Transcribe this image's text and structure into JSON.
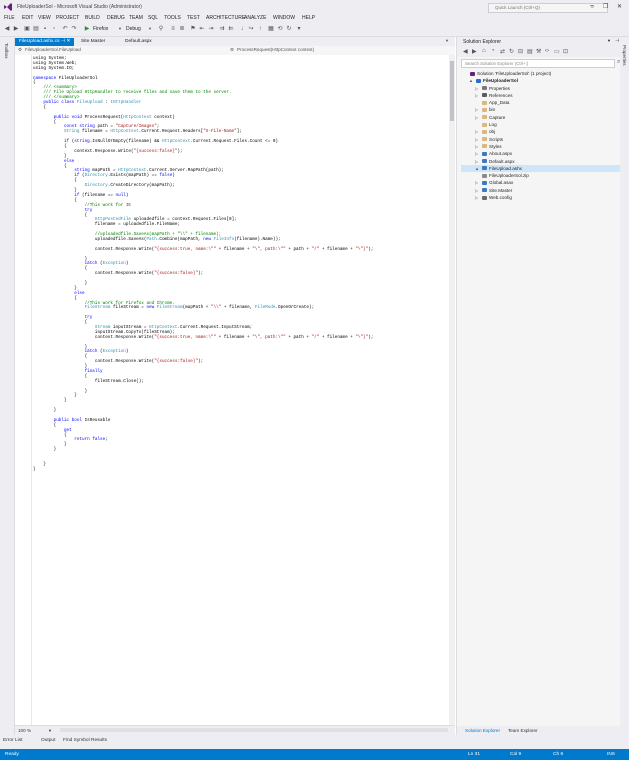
{
  "window": {
    "title": "FileUploaderSol - Microsoft Visual Studio (Administrator)",
    "quick_launch_placeholder": "Quick Launch (Ctrl+Q)",
    "menu": [
      "FILE",
      "EDIT",
      "VIEW",
      "PROJECT",
      "BUILD",
      "DEBUG",
      "TEAM",
      "SQL",
      "TOOLS",
      "TEST",
      "ARCHITECTURE",
      "ANALYZE",
      "WINDOW",
      "HELP"
    ]
  },
  "toolbar": {
    "browser": "Firefox",
    "config": "Debug"
  },
  "toolbox_label": "Toolbox",
  "tabs": [
    {
      "label": "FileUpload.ashx.cs",
      "active": true
    },
    {
      "label": "Site.Master",
      "active": false
    },
    {
      "label": "Default.aspx",
      "active": false
    }
  ],
  "navbar": {
    "left": "FileUploaderSol.FileUpload",
    "right": "ProcessRequest(HttpContext context)"
  },
  "code": [
    [
      {
        "t": "using System;",
        "k": "p"
      }
    ],
    [
      {
        "t": "using System.Web;",
        "k": "p"
      }
    ],
    [
      {
        "t": "using System.IO;",
        "k": "p"
      }
    ],
    [
      {
        "t": "",
        "k": "p"
      }
    ],
    [
      {
        "t": "namespace",
        "k": "kw"
      },
      {
        "t": " FileUploaderSol",
        "k": "p"
      }
    ],
    [
      {
        "t": "{",
        "k": "p"
      }
    ],
    [
      {
        "t": "    /// <summary>",
        "k": "cm"
      }
    ],
    [
      {
        "t": "    /// File Upload HttpHandler to receive files and save them to the server.",
        "k": "cm"
      }
    ],
    [
      {
        "t": "    /// </summary>",
        "k": "cm"
      }
    ],
    [
      {
        "t": "    public class ",
        "k": "kw"
      },
      {
        "t": "FileUpload",
        "k": "ty"
      },
      {
        "t": " : ",
        "k": "p"
      },
      {
        "t": "IHttpHandler",
        "k": "ty"
      }
    ],
    [
      {
        "t": "    {",
        "k": "p"
      }
    ],
    [
      {
        "t": "",
        "k": "p"
      }
    ],
    [
      {
        "t": "        public void ",
        "k": "kw"
      },
      {
        "t": "ProcessRequest(",
        "k": "p"
      },
      {
        "t": "HttpContext",
        "k": "ty"
      },
      {
        "t": " context)",
        "k": "p"
      }
    ],
    [
      {
        "t": "        {",
        "k": "p"
      }
    ],
    [
      {
        "t": "            const string ",
        "k": "kw"
      },
      {
        "t": "path = ",
        "k": "p"
      },
      {
        "t": "\"Capture/Images\"",
        "k": "str"
      },
      {
        "t": ";",
        "k": "p"
      }
    ],
    [
      {
        "t": "            String ",
        "k": "ty"
      },
      {
        "t": "filename = ",
        "k": "p"
      },
      {
        "t": "HttpContext",
        "k": "ty"
      },
      {
        "t": ".Current.Request.Headers[",
        "k": "p"
      },
      {
        "t": "\"X-File-Name\"",
        "k": "str"
      },
      {
        "t": "];",
        "k": "p"
      }
    ],
    [
      {
        "t": "",
        "k": "p"
      }
    ],
    [
      {
        "t": "            if ",
        "k": "kw"
      },
      {
        "t": "(",
        "k": "p"
      },
      {
        "t": "string",
        "k": "kw"
      },
      {
        "t": ".IsNullOrEmpty(filename) && ",
        "k": "p"
      },
      {
        "t": "HttpContext",
        "k": "ty"
      },
      {
        "t": ".Current.Request.Files.Count <= 0)",
        "k": "p"
      }
    ],
    [
      {
        "t": "            {",
        "k": "p"
      }
    ],
    [
      {
        "t": "                context.Response.Write(",
        "k": "p"
      },
      {
        "t": "\"{success:false}\"",
        "k": "str"
      },
      {
        "t": ");",
        "k": "p"
      }
    ],
    [
      {
        "t": "            }",
        "k": "p"
      }
    ],
    [
      {
        "t": "            else",
        "k": "kw"
      }
    ],
    [
      {
        "t": "            {",
        "k": "p"
      }
    ],
    [
      {
        "t": "                string ",
        "k": "kw"
      },
      {
        "t": "mapPath = ",
        "k": "p"
      },
      {
        "t": "HttpContext",
        "k": "ty"
      },
      {
        "t": ".Current.Server.MapPath(path);",
        "k": "p"
      }
    ],
    [
      {
        "t": "                if ",
        "k": "kw"
      },
      {
        "t": "(",
        "k": "p"
      },
      {
        "t": "Directory",
        "k": "ty"
      },
      {
        "t": ".Exists(mapPath) == ",
        "k": "p"
      },
      {
        "t": "false",
        "k": "kw"
      },
      {
        "t": ")",
        "k": "p"
      }
    ],
    [
      {
        "t": "                {",
        "k": "p"
      }
    ],
    [
      {
        "t": "                    Directory",
        "k": "ty"
      },
      {
        "t": ".CreateDirectory(mapPath);",
        "k": "p"
      }
    ],
    [
      {
        "t": "                }",
        "k": "p"
      }
    ],
    [
      {
        "t": "                if ",
        "k": "kw"
      },
      {
        "t": "(filename == ",
        "k": "p"
      },
      {
        "t": "null",
        "k": "kw"
      },
      {
        "t": ")",
        "k": "p"
      }
    ],
    [
      {
        "t": "                {",
        "k": "p"
      }
    ],
    [
      {
        "t": "                    //This work for IE",
        "k": "cm"
      }
    ],
    [
      {
        "t": "                    try",
        "k": "kw"
      }
    ],
    [
      {
        "t": "                    {",
        "k": "p"
      }
    ],
    [
      {
        "t": "                        HttpPostedFile ",
        "k": "ty"
      },
      {
        "t": "uploadedfile = context.Request.Files[0];",
        "k": "p"
      }
    ],
    [
      {
        "t": "                        filename = uploadedfile.FileName;",
        "k": "p"
      }
    ],
    [
      {
        "t": "",
        "k": "p"
      }
    ],
    [
      {
        "t": "                        //uploadedfile.SaveAs(mapPath + \"\\\\\" + filename);",
        "k": "cm"
      }
    ],
    [
      {
        "t": "                        uploadedfile.SaveAs(",
        "k": "p"
      },
      {
        "t": "Path",
        "k": "ty"
      },
      {
        "t": ".Combine(mapPath, ",
        "k": "p"
      },
      {
        "t": "new ",
        "k": "kw"
      },
      {
        "t": "FileInfo",
        "k": "ty"
      },
      {
        "t": "(filename).Name));",
        "k": "p"
      }
    ],
    [
      {
        "t": "",
        "k": "p"
      }
    ],
    [
      {
        "t": "                        context.Response.Write(",
        "k": "p"
      },
      {
        "t": "\"{success:true, name:\\\"\"",
        "k": "str"
      },
      {
        "t": " + filename + ",
        "k": "p"
      },
      {
        "t": "\"\\\", path:\\\"\"",
        "k": "str"
      },
      {
        "t": " + path + ",
        "k": "p"
      },
      {
        "t": "\"/\"",
        "k": "str"
      },
      {
        "t": " + filename + ",
        "k": "p"
      },
      {
        "t": "\"\\\"}\"",
        "k": "str"
      },
      {
        "t": ");",
        "k": "p"
      }
    ],
    [
      {
        "t": "",
        "k": "p"
      }
    ],
    [
      {
        "t": "                    }",
        "k": "p"
      }
    ],
    [
      {
        "t": "                    catch ",
        "k": "kw"
      },
      {
        "t": "(",
        "k": "p"
      },
      {
        "t": "Exception",
        "k": "ty"
      },
      {
        "t": ")",
        "k": "p"
      }
    ],
    [
      {
        "t": "                    {",
        "k": "p"
      }
    ],
    [
      {
        "t": "                        context.Response.Write(",
        "k": "p"
      },
      {
        "t": "\"{success:false}\"",
        "k": "str"
      },
      {
        "t": ");",
        "k": "p"
      }
    ],
    [
      {
        "t": "",
        "k": "p"
      }
    ],
    [
      {
        "t": "                    }",
        "k": "p"
      }
    ],
    [
      {
        "t": "                }",
        "k": "p"
      }
    ],
    [
      {
        "t": "                else",
        "k": "kw"
      }
    ],
    [
      {
        "t": "                {",
        "k": "p"
      }
    ],
    [
      {
        "t": "                    //This work for Firefox and Chrome.",
        "k": "cm"
      }
    ],
    [
      {
        "t": "                    FileStream ",
        "k": "ty"
      },
      {
        "t": "fileStream = ",
        "k": "p"
      },
      {
        "t": "new ",
        "k": "kw"
      },
      {
        "t": "FileStream",
        "k": "ty"
      },
      {
        "t": "(mapPath + ",
        "k": "p"
      },
      {
        "t": "\"\\\\\"",
        "k": "str"
      },
      {
        "t": " + filename, ",
        "k": "p"
      },
      {
        "t": "FileMode",
        "k": "ty"
      },
      {
        "t": ".OpenOrCreate);",
        "k": "p"
      }
    ],
    [
      {
        "t": "",
        "k": "p"
      }
    ],
    [
      {
        "t": "                    try",
        "k": "kw"
      }
    ],
    [
      {
        "t": "                    {",
        "k": "p"
      }
    ],
    [
      {
        "t": "                        Stream ",
        "k": "ty"
      },
      {
        "t": "inputStream = ",
        "k": "p"
      },
      {
        "t": "HttpContext",
        "k": "ty"
      },
      {
        "t": ".Current.Request.InputStream;",
        "k": "p"
      }
    ],
    [
      {
        "t": "                        inputStream.CopyTo(fileStream);",
        "k": "p"
      }
    ],
    [
      {
        "t": "                        context.Response.Write(",
        "k": "p"
      },
      {
        "t": "\"{success:true, name:\\\"\"",
        "k": "str"
      },
      {
        "t": " + filename + ",
        "k": "p"
      },
      {
        "t": "\"\\\", path:\\\"\"",
        "k": "str"
      },
      {
        "t": " + path + ",
        "k": "p"
      },
      {
        "t": "\"/\"",
        "k": "str"
      },
      {
        "t": " + filename + ",
        "k": "p"
      },
      {
        "t": "\"\\\"}\"",
        "k": "str"
      },
      {
        "t": ");",
        "k": "p"
      }
    ],
    [
      {
        "t": "",
        "k": "p"
      }
    ],
    [
      {
        "t": "                    }",
        "k": "p"
      }
    ],
    [
      {
        "t": "                    catch ",
        "k": "kw"
      },
      {
        "t": "(",
        "k": "p"
      },
      {
        "t": "Exception",
        "k": "ty"
      },
      {
        "t": ")",
        "k": "p"
      }
    ],
    [
      {
        "t": "                    {",
        "k": "p"
      }
    ],
    [
      {
        "t": "                        context.Response.Write(",
        "k": "p"
      },
      {
        "t": "\"{success:false}\"",
        "k": "str"
      },
      {
        "t": ");",
        "k": "p"
      }
    ],
    [
      {
        "t": "                    }",
        "k": "p"
      }
    ],
    [
      {
        "t": "                    finally",
        "k": "kw"
      }
    ],
    [
      {
        "t": "                    {",
        "k": "p"
      }
    ],
    [
      {
        "t": "                        fileStream.Close();",
        "k": "p"
      }
    ],
    [
      {
        "t": "",
        "k": "p"
      }
    ],
    [
      {
        "t": "                    }",
        "k": "p"
      }
    ],
    [
      {
        "t": "                }",
        "k": "p"
      }
    ],
    [
      {
        "t": "            }",
        "k": "p"
      }
    ],
    [
      {
        "t": "",
        "k": "p"
      }
    ],
    [
      {
        "t": "        }",
        "k": "p"
      }
    ],
    [
      {
        "t": "",
        "k": "p"
      }
    ],
    [
      {
        "t": "        public bool ",
        "k": "kw"
      },
      {
        "t": "IsReusable",
        "k": "p"
      }
    ],
    [
      {
        "t": "        {",
        "k": "p"
      }
    ],
    [
      {
        "t": "            get",
        "k": "kw"
      }
    ],
    [
      {
        "t": "            {",
        "k": "p"
      }
    ],
    [
      {
        "t": "                return false",
        "k": "kw"
      },
      {
        "t": ";",
        "k": "p"
      }
    ],
    [
      {
        "t": "            }",
        "k": "p"
      }
    ],
    [
      {
        "t": "        }",
        "k": "p"
      }
    ],
    [
      {
        "t": "",
        "k": "p"
      }
    ],
    [
      {
        "t": "",
        "k": "p"
      }
    ],
    [
      {
        "t": "    }",
        "k": "p"
      }
    ],
    [
      {
        "t": "}",
        "k": "p"
      }
    ]
  ],
  "zoom": "100 %",
  "bottom_tabs": [
    "Error List",
    "Output",
    "Find Symbol Results"
  ],
  "status": {
    "left": "Ready",
    "ln": "Ln 31",
    "col": "Col 9",
    "ch": "Ch 6",
    "ins": "INS"
  },
  "solution_explorer": {
    "title": "Solution Explorer",
    "search_placeholder": "Search Solution Explorer (Ctrl+;)",
    "tree": [
      {
        "label": "Solution 'FileUploaderSol' (1 project)",
        "depth": 0,
        "icon": "solution",
        "expander": "",
        "color": "#68217a"
      },
      {
        "label": "FileUploaderSol",
        "depth": 1,
        "icon": "project",
        "expander": "▲",
        "color": "#2b6ec7",
        "bold": true
      },
      {
        "label": "Properties",
        "depth": 2,
        "icon": "wrench",
        "expander": "▷",
        "color": "#7a7a7a"
      },
      {
        "label": "References",
        "depth": 2,
        "icon": "references",
        "expander": "▷",
        "color": "#5a5a5a"
      },
      {
        "label": "App_Data",
        "depth": 2,
        "icon": "folder",
        "expander": "",
        "color": "#dcb67a"
      },
      {
        "label": "bin",
        "depth": 2,
        "icon": "folder",
        "expander": "▷",
        "color": "#dcb67a"
      },
      {
        "label": "Capture",
        "depth": 2,
        "icon": "folder",
        "expander": "▷",
        "color": "#dcb67a"
      },
      {
        "label": "Log",
        "depth": 2,
        "icon": "folder",
        "expander": "",
        "color": "#dcb67a"
      },
      {
        "label": "obj",
        "depth": 2,
        "icon": "folder",
        "expander": "▷",
        "color": "#dcb67a"
      },
      {
        "label": "Scripts",
        "depth": 2,
        "icon": "folder",
        "expander": "▷",
        "color": "#dcb67a"
      },
      {
        "label": "Styles",
        "depth": 2,
        "icon": "folder",
        "expander": "▷",
        "color": "#dcb67a"
      },
      {
        "label": "About.aspx",
        "depth": 2,
        "icon": "aspx",
        "expander": "▷",
        "color": "#3c78c3"
      },
      {
        "label": "Default.aspx",
        "depth": 2,
        "icon": "aspx",
        "expander": "▷",
        "color": "#3c78c3"
      },
      {
        "label": "FileUpload.ashx",
        "depth": 2,
        "icon": "ashx",
        "expander": "▲",
        "color": "#3c78c3",
        "selected": true
      },
      {
        "label": "FileUploaderSol.zip",
        "depth": 2,
        "icon": "zip",
        "expander": "",
        "color": "#8a8a8a"
      },
      {
        "label": "Global.asax",
        "depth": 2,
        "icon": "asax",
        "expander": "▷",
        "color": "#3c78c3"
      },
      {
        "label": "Site.Master",
        "depth": 2,
        "icon": "master",
        "expander": "▷",
        "color": "#3c78c3"
      },
      {
        "label": "Web.config",
        "depth": 2,
        "icon": "config",
        "expander": "▷",
        "color": "#6a6a6a"
      }
    ],
    "bottom_tabs": [
      "Solution Explorer",
      "Team Explorer"
    ]
  },
  "right_strip_label": "Properties",
  "colors": {
    "accent": "#007acc",
    "keyword": "#0000ff",
    "type": "#2b91af",
    "string": "#a31515",
    "comment": "#008000"
  }
}
